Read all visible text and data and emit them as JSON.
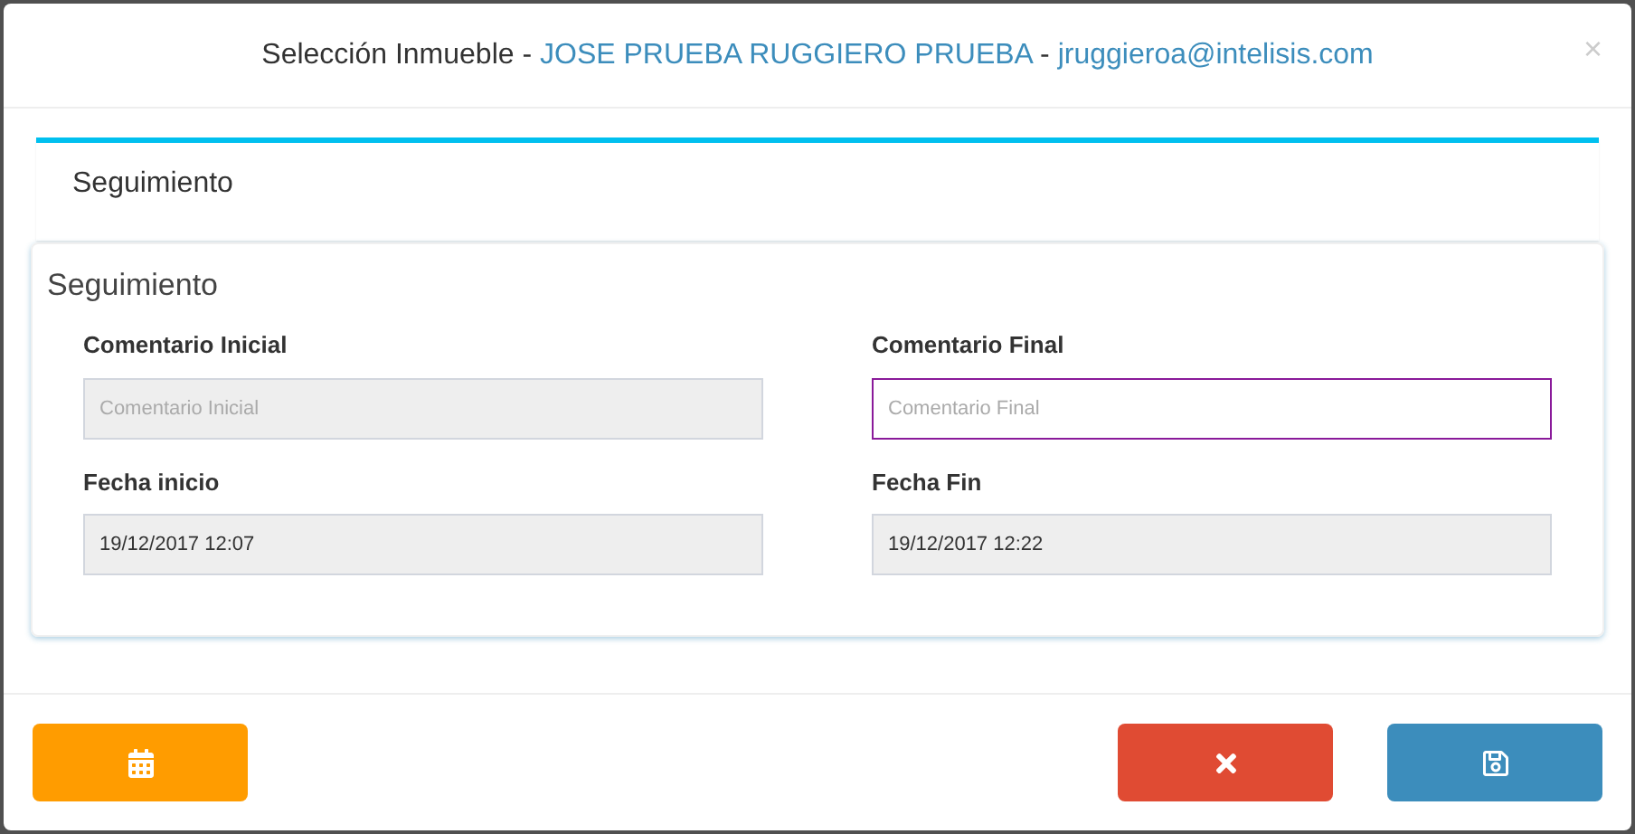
{
  "dialog": {
    "title_parts": [
      {
        "text": "Selección Inmueble -",
        "kind": "plain"
      },
      {
        "text": "JOSE PRUEBA RUGGIERO PRUEBA",
        "kind": "link"
      },
      {
        "text": "-",
        "kind": "plain"
      },
      {
        "text": "jruggieroa@intelisis.com",
        "kind": "link"
      }
    ],
    "close": "×"
  },
  "panel": {
    "title": "Seguimiento"
  },
  "section": {
    "title": "Seguimiento",
    "fields": [
      {
        "label": "Comentario Inicial",
        "placeholder": "Comentario Inicial",
        "disabled": true,
        "focused": false
      },
      {
        "label": "Comentario Final",
        "placeholder": "Comentario Final",
        "disabled": false,
        "focused": true
      },
      {
        "label": "Fecha inicio",
        "value": "19/12/2017 12:07",
        "disabled": true,
        "focused": false
      },
      {
        "label": "Fecha Fin",
        "value": "19/12/2017 12:22",
        "disabled": true,
        "focused": false
      }
    ]
  },
  "buttons": [
    {
      "kind": "calendar"
    },
    {
      "kind": "cancel"
    },
    {
      "kind": "save"
    }
  ]
}
